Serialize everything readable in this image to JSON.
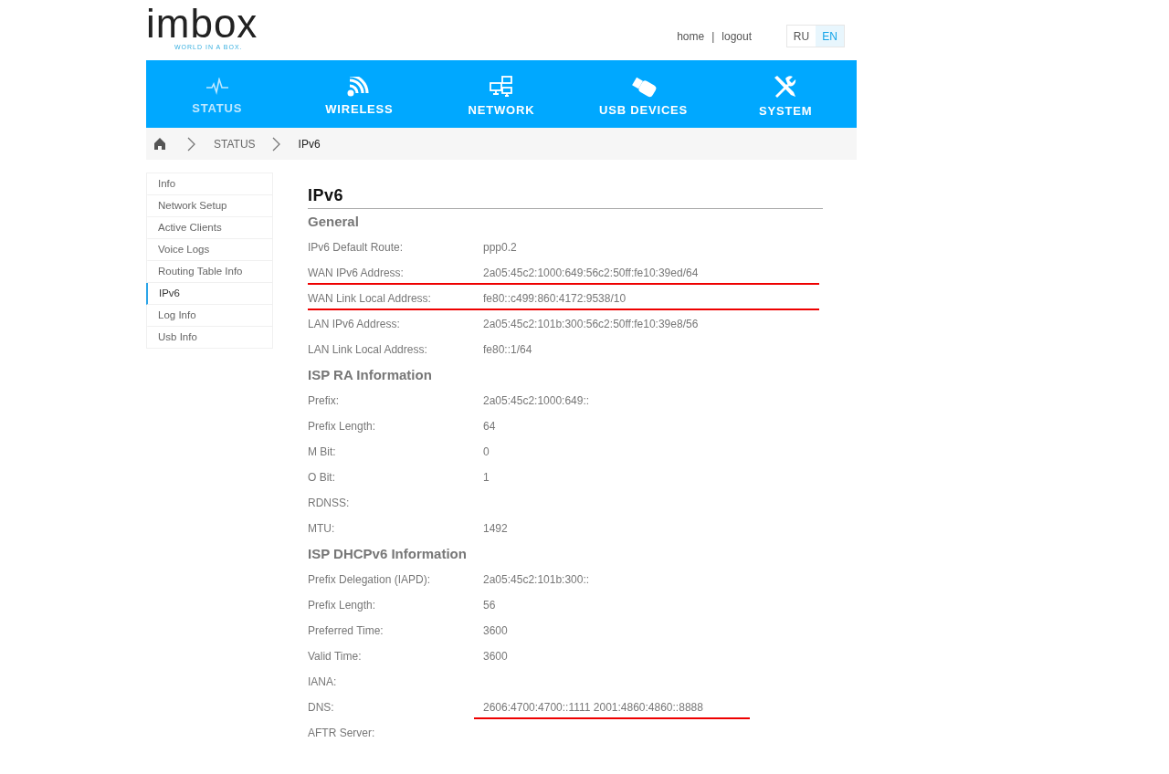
{
  "logo": {
    "text": "imbox",
    "tagline": "WORLD IN A BOX."
  },
  "top_links": [
    "home",
    "logout"
  ],
  "top_separator": "|",
  "languages": [
    {
      "label": "RU",
      "selected": false
    },
    {
      "label": "EN",
      "selected": true
    }
  ],
  "nav": [
    {
      "label": "STATUS",
      "kind": "pulse",
      "selected": true
    },
    {
      "label": "WIRELESS",
      "kind": "wifi",
      "selected": false
    },
    {
      "label": "NETWORK",
      "kind": "network",
      "selected": false
    },
    {
      "label": "USB DEVICES",
      "kind": "usb",
      "selected": false
    },
    {
      "label": "SYSTEM",
      "kind": "tools",
      "selected": false
    }
  ],
  "breadcrumb": [
    "STATUS",
    "IPv6"
  ],
  "sidebar": {
    "items": [
      {
        "label": "Info",
        "selected": false
      },
      {
        "label": "Network Setup",
        "selected": false
      },
      {
        "label": "Active Clients",
        "selected": false
      },
      {
        "label": "Voice Logs",
        "selected": false
      },
      {
        "label": "Routing Table Info",
        "selected": false
      },
      {
        "label": "IPv6",
        "selected": true
      },
      {
        "label": "Log Info",
        "selected": false
      },
      {
        "label": "Usb Info",
        "selected": false
      }
    ]
  },
  "page_title": "IPv6",
  "sections": [
    {
      "title": "General",
      "rows": [
        {
          "kind": "plain",
          "label": "IPv6 Default Route:",
          "value": "ppp0.2"
        },
        {
          "kind": "underlined",
          "label": "WAN IPv6 Address:",
          "value": "2a05:45c2:1000:649:56c2:50ff:fe10:39ed/64"
        },
        {
          "kind": "underlined",
          "label": "WAN Link Local Address:",
          "value": "fe80::c499:860:4172:9538/10"
        },
        {
          "kind": "plain",
          "label": "LAN IPv6 Address:",
          "value": "2a05:45c2:101b:300:56c2:50ff:fe10:39e8/56"
        },
        {
          "kind": "plain",
          "label": "LAN Link Local Address:",
          "value": "fe80::1/64"
        }
      ]
    },
    {
      "title": "ISP RA Information",
      "rows": [
        {
          "kind": "plain",
          "label": "Prefix:",
          "value": "2a05:45c2:1000:649::"
        },
        {
          "kind": "plain",
          "label": "Prefix Length:",
          "value": "64"
        },
        {
          "kind": "plain",
          "label": "M Bit:",
          "value": "0"
        },
        {
          "kind": "plain",
          "label": "O Bit:",
          "value": "1"
        },
        {
          "kind": "plain",
          "label": "RDNSS:"
        },
        {
          "kind": "plain",
          "label": "MTU:",
          "value": "1492"
        }
      ]
    },
    {
      "title": "ISP DHCPv6 Information",
      "rows": [
        {
          "kind": "plain",
          "label": "Prefix Delegation (IAPD):",
          "value": "2a05:45c2:101b:300::"
        },
        {
          "kind": "plain",
          "label": "Prefix Length:",
          "value": "56"
        },
        {
          "kind": "plain",
          "label": "Preferred Time:",
          "value": "3600"
        },
        {
          "kind": "plain",
          "label": "Valid Time:",
          "value": "3600"
        },
        {
          "kind": "plain",
          "label": "IANA:"
        },
        {
          "kind": "value_underlined",
          "label": "DNS:",
          "value": "2606:4700:4700::1111 2001:4860:4860::8888"
        },
        {
          "kind": "plain",
          "label": "AFTR Server:"
        }
      ]
    }
  ]
}
